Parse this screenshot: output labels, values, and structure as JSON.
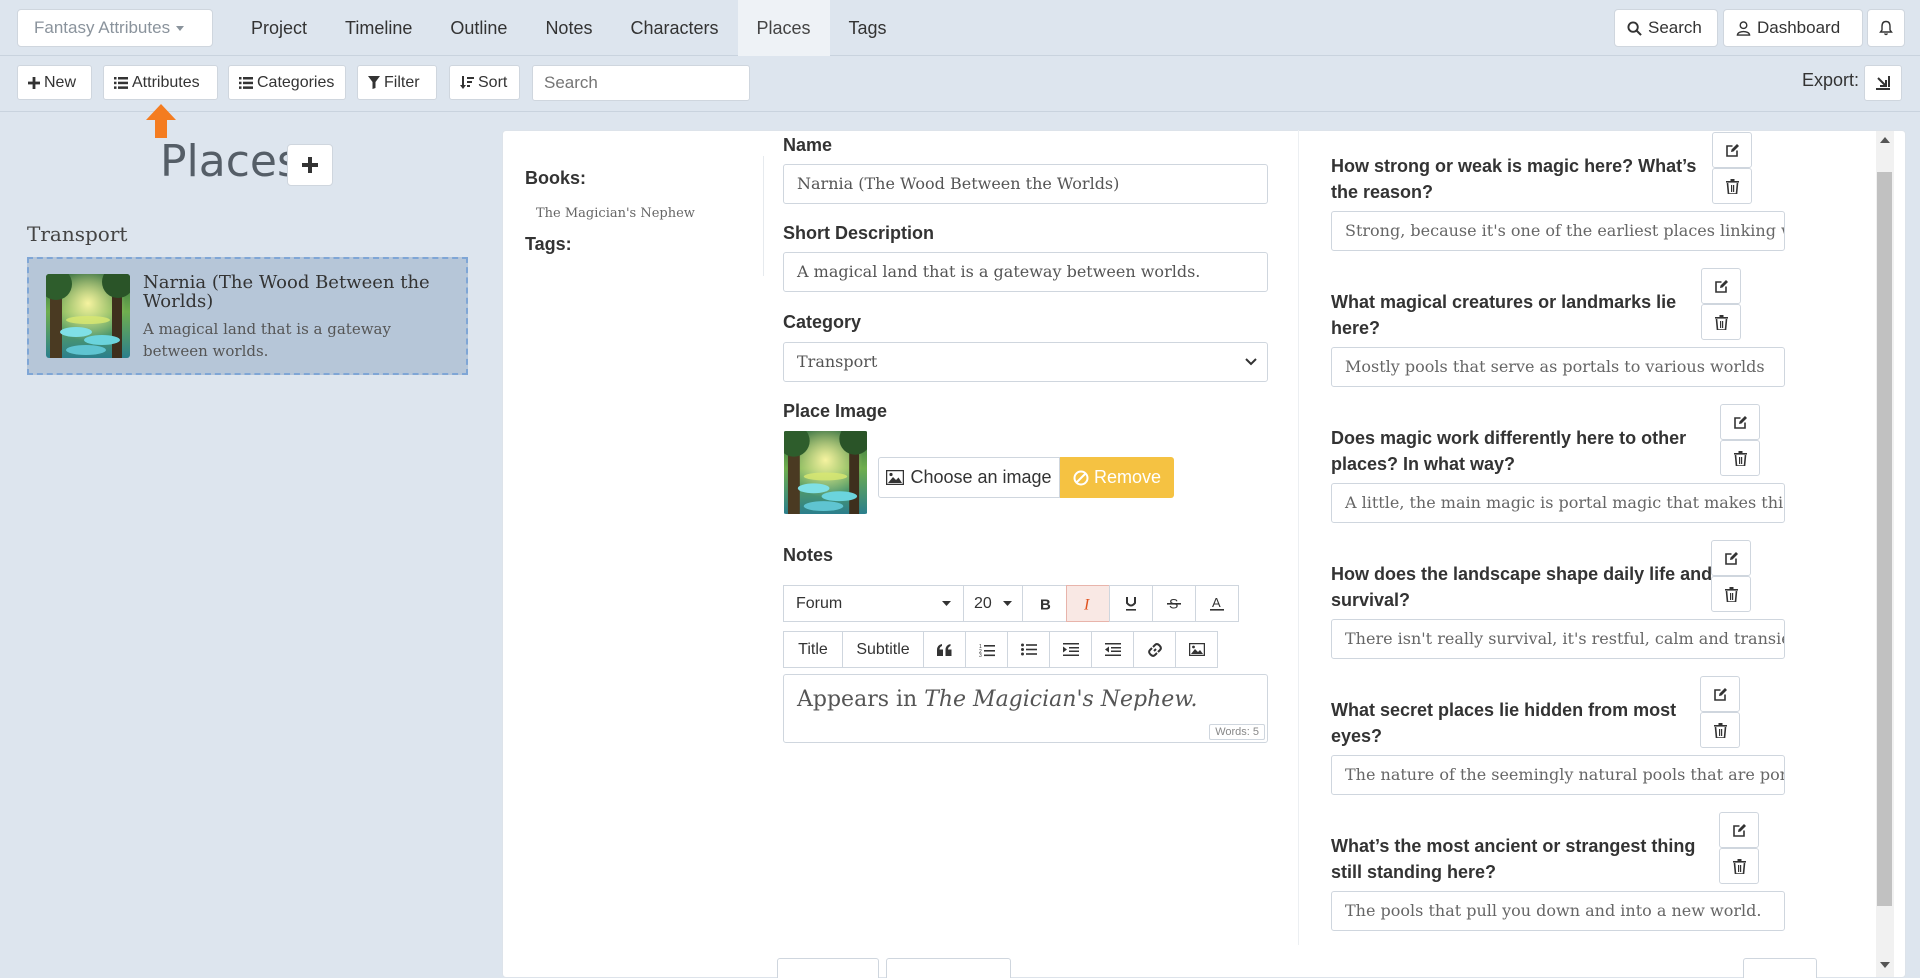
{
  "project_dropdown": "Fantasy Attributes",
  "tabs": [
    "Project",
    "Timeline",
    "Outline",
    "Notes",
    "Characters",
    "Places",
    "Tags"
  ],
  "active_tab": "Places",
  "top_right": {
    "search": "Search",
    "dashboard": "Dashboard"
  },
  "toolbar": {
    "new": "New",
    "attributes": "Attributes",
    "categories": "Categories",
    "filter": "Filter",
    "sort": "Sort",
    "search_placeholder": "Search",
    "export": "Export:"
  },
  "left": {
    "title": "Places",
    "category": "Transport",
    "card": {
      "name": "Narnia (The Wood Between the Worlds)",
      "desc": "A magical land that is a gateway between worlds."
    }
  },
  "sidebar_meta": {
    "books_label": "Books:",
    "book": "The Magician's Nephew",
    "tags_label": "Tags:"
  },
  "form": {
    "name_label": "Name",
    "name_value": "Narnia (The Wood Between the Worlds)",
    "short_label": "Short Description",
    "short_value": "A magical land that is a gateway between worlds.",
    "category_label": "Category",
    "category_value": "Transport",
    "image_label": "Place Image",
    "choose_image": "Choose an image",
    "remove": "Remove",
    "notes_label": "Notes",
    "font": "Forum",
    "font_size": "20",
    "title_btn": "Title",
    "subtitle_btn": "Subtitle",
    "notes_text_prefix": "Appears in ",
    "notes_text_italic": "The Magician's Nephew.",
    "word_count": "Words: 5"
  },
  "questions": [
    {
      "q": "How strong or weak is magic here? What’s the reason?",
      "a": "Strong, because it's one of the earliest places linking worlds"
    },
    {
      "q": "What magical creatures or landmarks lie here?",
      "a": "Mostly pools that serve as portals to various worlds"
    },
    {
      "q": "Does magic work differently here to other places? In what way?",
      "a": "A little, the main magic is portal magic that makes this like"
    },
    {
      "q": "How does the landscape shape daily life and survival?",
      "a": "There isn't really survival, it's restful, calm and transient."
    },
    {
      "q": "What secret places lie hidden from most eyes?",
      "a": "The nature of the seemingly natural pools that are portals."
    },
    {
      "q": "What’s the most ancient or strangest thing still standing here?",
      "a": "The pools that pull you down and into a new world."
    }
  ]
}
